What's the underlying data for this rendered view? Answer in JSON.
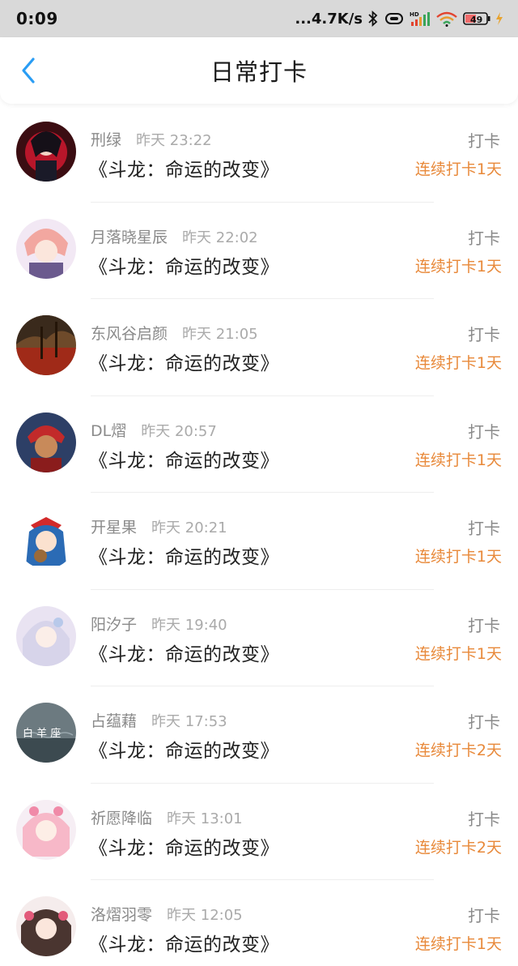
{
  "status_bar": {
    "time": "0:09",
    "network": "...4.7K/s",
    "battery": "49"
  },
  "header": {
    "title": "日常打卡"
  },
  "colors": {
    "accent_blue": "#2a9df4",
    "streak_orange": "#e8893a"
  },
  "checkins": [
    {
      "name": "刑绿",
      "time": "昨天 23:22",
      "book": "《斗龙：命运的改变》",
      "tag": "打卡",
      "streak": "连续打卡1天"
    },
    {
      "name": "月落晓星辰",
      "time": "昨天 22:02",
      "book": "《斗龙：命运的改变》",
      "tag": "打卡",
      "streak": "连续打卡1天"
    },
    {
      "name": "东风谷启颜",
      "time": "昨天 21:05",
      "book": "《斗龙：命运的改变》",
      "tag": "打卡",
      "streak": "连续打卡1天"
    },
    {
      "name": "DL熠",
      "time": "昨天 20:57",
      "book": "《斗龙：命运的改变》",
      "tag": "打卡",
      "streak": "连续打卡1天"
    },
    {
      "name": "开星果",
      "time": "昨天 20:21",
      "book": "《斗龙：命运的改变》",
      "tag": "打卡",
      "streak": "连续打卡1天"
    },
    {
      "name": "阳汐子",
      "time": "昨天 19:40",
      "book": "《斗龙：命运的改变》",
      "tag": "打卡",
      "streak": "连续打卡1天"
    },
    {
      "name": "占蕴藉",
      "time": "昨天 17:53",
      "book": "《斗龙：命运的改变》",
      "tag": "打卡",
      "streak": "连续打卡2天"
    },
    {
      "name": "祈愿降临",
      "time": "昨天 13:01",
      "book": "《斗龙：命运的改变》",
      "tag": "打卡",
      "streak": "连续打卡2天"
    },
    {
      "name": "洛熠羽零",
      "time": "昨天 12:05",
      "book": "《斗龙：命运的改变》",
      "tag": "打卡",
      "streak": "连续打卡1天"
    }
  ]
}
